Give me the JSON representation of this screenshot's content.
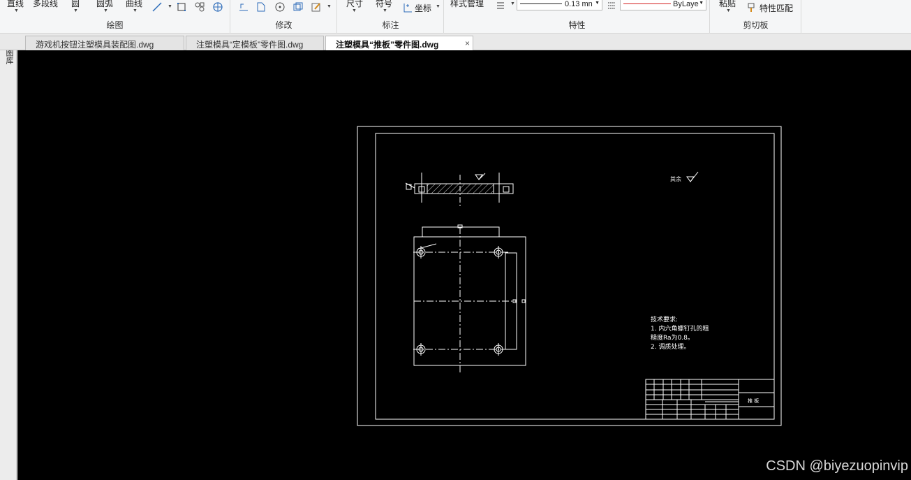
{
  "ribbon": {
    "draw": {
      "title": "绘图",
      "line": "直线",
      "polyline": "多段线",
      "circle": "圆",
      "arc": "圆弧",
      "curve": "曲线"
    },
    "modify": {
      "title": "修改"
    },
    "annotate": {
      "title": "标注",
      "dimension": "尺寸",
      "symbol": "符号",
      "coordinate": "坐标"
    },
    "properties": {
      "title": "特性",
      "style_manager": "样式管理",
      "lineweight": "0.13 mn",
      "linetype": "ByLaye"
    },
    "clipboard": {
      "title": "剪切板",
      "paste": "粘贴",
      "match_properties": "特性匹配"
    }
  },
  "left_strip": {
    "label": "图库"
  },
  "tabs": [
    {
      "label": "游戏机按钮注塑模具装配图.dwg",
      "active": false
    },
    {
      "label": "注塑模具“定模板”零件图.dwg",
      "active": false
    },
    {
      "label": "注塑模具“推板”零件图.dwg",
      "active": true,
      "close": "×"
    }
  ],
  "drawing": {
    "tech_title": "技术要求:",
    "tech_line1": "1. 内六角螺钉孔的粗",
    "tech_line2": "糙度Ra为0.8。",
    "tech_line3": "2. 调质处理。",
    "part_name": "推  板",
    "rough_label": "其余"
  },
  "watermark": "CSDN @biyezuopinvip",
  "colors": {
    "canvas_bg": "#000000",
    "drawing_lines": "#ffffff",
    "linetype_red": "#d42020"
  }
}
